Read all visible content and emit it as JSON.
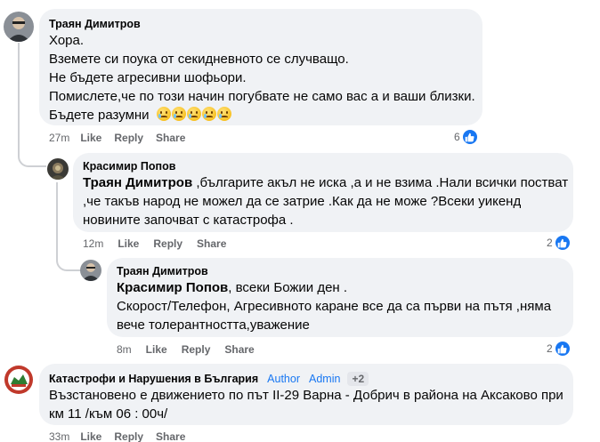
{
  "colors": {
    "link": "#1877f2",
    "meta": "#65676b",
    "bubble": "#f0f2f5",
    "thread": "#ced0d4"
  },
  "comments": [
    {
      "author": "Траян Димитров",
      "lines": [
        "Хора.",
        "Вземете си поука от секидневното се случващо.",
        "Не бъдете агресивни шофьори.",
        "Помислете,че по този начин погубвате не само вас а и ваши близки.",
        "Бъдете разумни"
      ],
      "emoji_count": 5,
      "time": "27m",
      "like": "Like",
      "reply": "Reply",
      "share": "Share",
      "reactions": "6"
    },
    {
      "author": "Красимир Попов",
      "mention": "Траян Димитров",
      "line1_rest": " ,българите акъл не иска ,а и не взима .Нали всички постват",
      "line2": ",че такъв народ не можел да се затрие .Как да не може ?Всеки уикенд",
      "line3": "новините започват с катастрофа .",
      "time": "12m",
      "like": "Like",
      "reply": "Reply",
      "share": "Share",
      "reactions": "2"
    },
    {
      "author": "Траян Димитров",
      "mention": "Красимир Попов",
      "line1_rest": ", всеки Божии ден .",
      "line2": "Скорост/Телефон, Агресивното каране все да са първи на пътя ,няма",
      "line3": "вече толерантността,уважение",
      "time": "8m",
      "like": "Like",
      "reply": "Reply",
      "share": "Share",
      "reactions": "2"
    },
    {
      "author": "Катастрофи и Нарушения в България",
      "badge_author": "Author",
      "badge_admin": "Admin",
      "badge_more": "+2",
      "line1": "Възстановено е движението по път II-29 Варна - Добрич в района на Аксаково при",
      "line2": "км 11 /към 06 : 00ч/",
      "time": "33m",
      "like": "Like",
      "reply": "Reply",
      "share": "Share"
    }
  ],
  "icons": {
    "like": "thumbs-up-icon",
    "emoji": "crying-face-icon"
  }
}
